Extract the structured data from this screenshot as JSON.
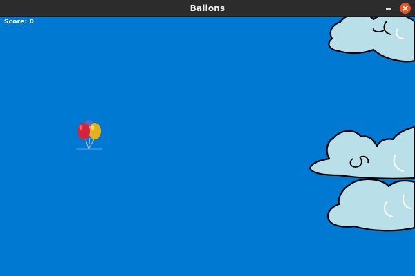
{
  "window": {
    "title": "Ballons"
  },
  "hud": {
    "score_text": "Score: 0"
  },
  "colors": {
    "sky": "#0079d3",
    "cloud_fill": "#b9dfe8",
    "cloud_outline": "#000000",
    "titlebar": "#2c2c2c",
    "close_button": "#e95420"
  },
  "icons": {
    "close": "close-icon",
    "minimize": "minimize-icon",
    "balloons": "balloon-cluster"
  }
}
